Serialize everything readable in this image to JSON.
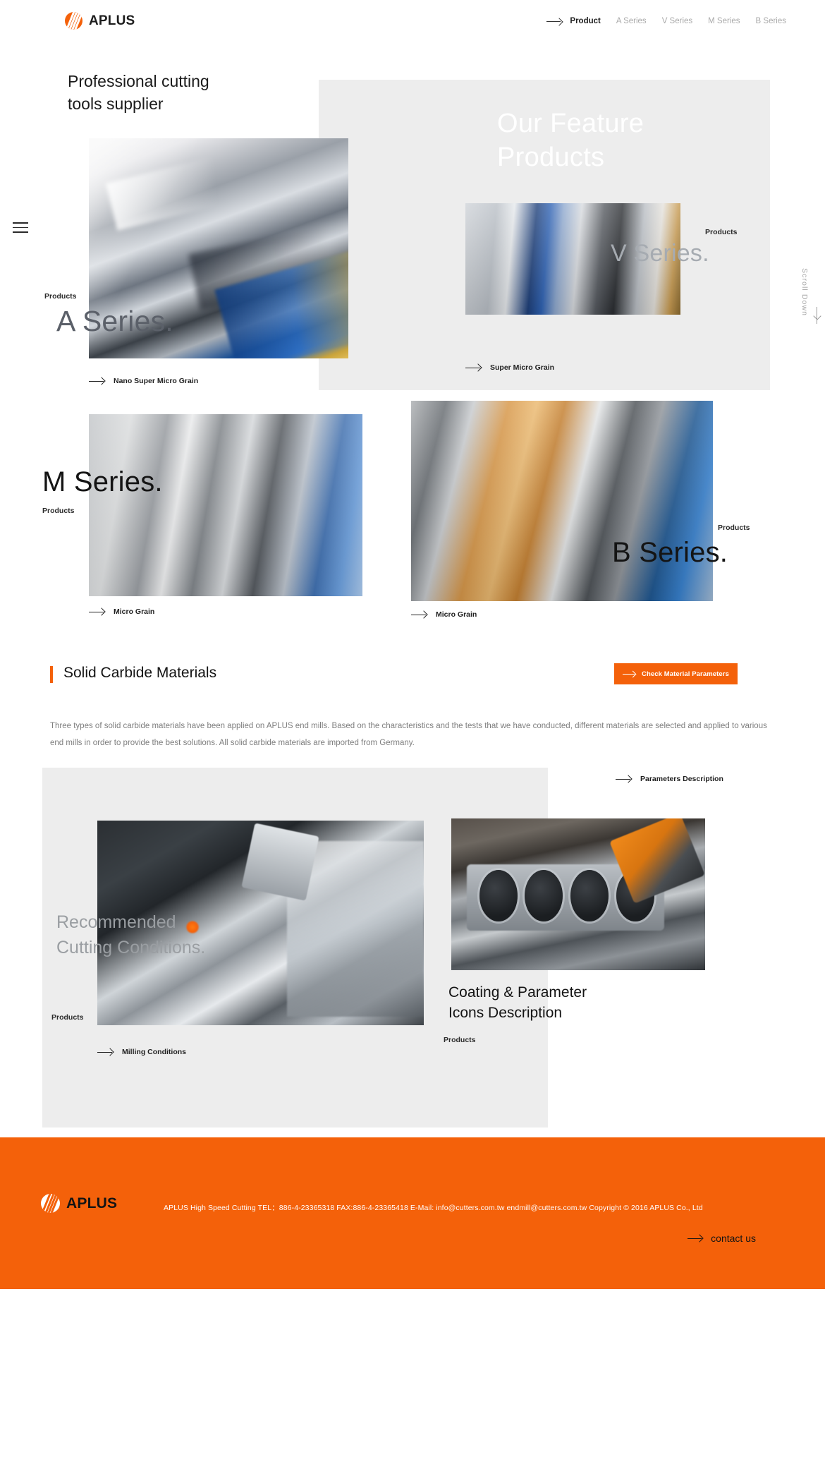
{
  "header": {
    "logo_text": "APLUS",
    "nav": [
      {
        "label": "Product",
        "current": true
      },
      {
        "label": "A Series",
        "current": false
      },
      {
        "label": "V Series",
        "current": false
      },
      {
        "label": "M Series",
        "current": false
      },
      {
        "label": "B Series",
        "current": false
      }
    ]
  },
  "side": {
    "scroll_down": "Scroll Down"
  },
  "hero": {
    "title": "Professional cutting\ntools supplier",
    "feature_heading": "Our Feature\nProducts"
  },
  "products": {
    "label": "Products",
    "items": [
      {
        "title": "A Series.",
        "link": "Nano Super Micro Grain"
      },
      {
        "title": "V Series.",
        "link": "Super Micro Grain"
      },
      {
        "title": "M Series.",
        "link": "Micro Grain"
      },
      {
        "title": "B Series.",
        "link": "Micro Grain"
      }
    ]
  },
  "materials": {
    "title": "Solid Carbide Materials",
    "button_label": "Check Material Parameters",
    "body": "Three types of solid carbide materials have been applied on APLUS end mills. Based on the characteristics and the tests that we have conducted, different materials are selected and applied to various end mills in order to provide the best solutions. All solid carbide materials are imported from Germany."
  },
  "lower": {
    "label": "Products",
    "parameters_link": "Parameters Description",
    "cutting_conditions_title": "Recommended\nCutting Conditions.",
    "cutting_conditions_link": "Milling Conditions",
    "coating_title": "Coating & Parameter\nIcons Description"
  },
  "footer": {
    "logo_text": "APLUS",
    "info": "APLUS High Speed Cutting   TEL：886-4-23365318  FAX:886-4-23365418  E-Mail: info@cutters.com.tw endmill@cutters.com.tw   Copyright © 2016 APLUS Co., Ltd",
    "contact_label": "contact us"
  },
  "colors": {
    "brand_orange": "#f4610a",
    "panel_gray": "#ededed",
    "text_dark": "#141414",
    "text_muted": "#a9a9a9"
  }
}
